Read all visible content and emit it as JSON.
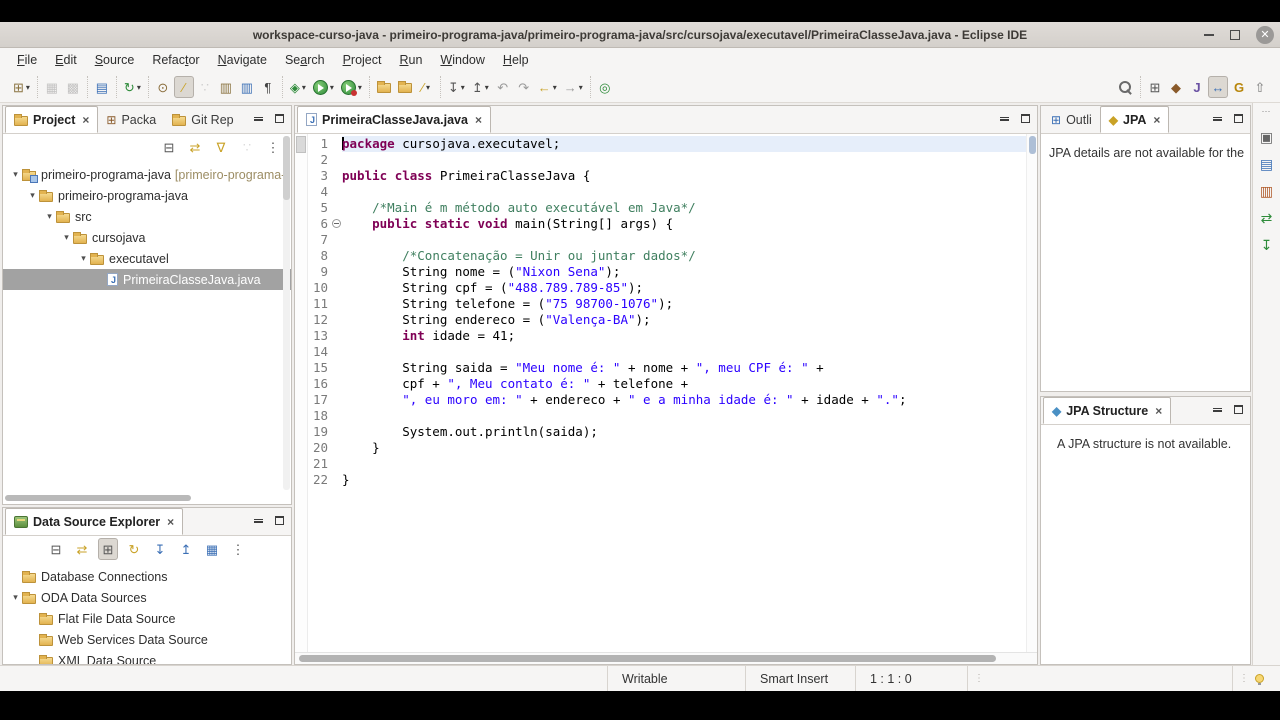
{
  "window": {
    "title": "workspace-curso-java - primeiro-programa-java/primeiro-programa-java/src/cursojava/executavel/PrimeiraClasseJava.java - Eclipse IDE"
  },
  "menu_bar": {
    "items": [
      {
        "label": "File",
        "m": 0
      },
      {
        "label": "Edit",
        "m": 0
      },
      {
        "label": "Source",
        "m": 0
      },
      {
        "label": "Refactor",
        "m": 5
      },
      {
        "label": "Navigate",
        "m": 0
      },
      {
        "label": "Search",
        "m": 2
      },
      {
        "label": "Project",
        "m": 0
      },
      {
        "label": "Run",
        "m": 0
      },
      {
        "label": "Window",
        "m": 0
      },
      {
        "label": "Help",
        "m": 0
      }
    ]
  },
  "toolbar": {
    "left_groups": [
      [
        {
          "name": "new-wizard-button",
          "glyph": "⊞",
          "color": "#8a7340",
          "dd": true
        }
      ],
      [
        {
          "name": "save-button",
          "glyph": "▦",
          "color": "#666",
          "disabled": true
        },
        {
          "name": "save-all-button",
          "glyph": "▩",
          "color": "#666",
          "disabled": true
        }
      ],
      [
        {
          "name": "console-button",
          "glyph": "▤",
          "color": "#3b6fb5"
        }
      ],
      [
        {
          "name": "run-last-tool-button",
          "glyph": "↻",
          "color": "#2e8b3a",
          "dd": true
        }
      ],
      [
        {
          "name": "open-search-dialog-button",
          "glyph": "⊙",
          "color": "#8a6d3b"
        },
        {
          "name": "mark-occurrences-button",
          "glyph": "∕",
          "color": "#c9a227",
          "pressed": true
        },
        {
          "name": "content-assist-button",
          "glyph": "∵",
          "color": "#888",
          "disabled": true
        },
        {
          "name": "open-task-button",
          "glyph": "▥",
          "color": "#8a7340"
        },
        {
          "name": "problems-view-button",
          "glyph": "▥",
          "color": "#3b6fb5"
        },
        {
          "name": "show-whitespace-button",
          "glyph": "¶",
          "color": "#444"
        }
      ],
      [
        {
          "name": "debug-button",
          "glyph": "◈",
          "color": "#2e8b3a",
          "dd": true
        },
        {
          "name": "run-button",
          "css": "run",
          "dd": true
        },
        {
          "name": "coverage-button",
          "css": "run-red",
          "dd": true
        }
      ],
      [
        {
          "name": "open-type-button",
          "css": "folder"
        },
        {
          "name": "open-resource-button",
          "css": "folder"
        },
        {
          "name": "annotate-button",
          "glyph": "∕",
          "color": "#c9a227",
          "dd": true
        }
      ],
      [
        {
          "name": "next-annotation-button",
          "glyph": "↧",
          "color": "#555",
          "dd": true
        },
        {
          "name": "previous-annotation-button",
          "glyph": "↥",
          "color": "#555",
          "dd": true
        },
        {
          "name": "last-edit-back-button",
          "glyph": "↶",
          "color": "#9a9a9a"
        },
        {
          "name": "last-edit-forward-button",
          "glyph": "↷",
          "color": "#9a9a9a"
        },
        {
          "name": "back-button",
          "glyph": "←",
          "color": "#c9a227",
          "dd": true
        },
        {
          "name": "forward-button",
          "glyph": "→",
          "color": "#9a9a9a",
          "dd": true
        }
      ],
      [
        {
          "name": "pin-editor-button",
          "glyph": "◎",
          "color": "#2e8b3a"
        }
      ]
    ],
    "right_groups": [
      [
        {
          "name": "search-button",
          "css": "magnifier"
        }
      ],
      [
        {
          "name": "open-perspective-button",
          "glyph": "⊞",
          "color": "#555"
        },
        {
          "name": "jpa-perspective-button",
          "glyph": "◆",
          "color": "#8a5a2a"
        },
        {
          "name": "java-perspective-button",
          "glyph": "J",
          "color": "#6a51a3"
        },
        {
          "name": "javaee-perspective-button",
          "glyph": "↔",
          "color": "#3b6fb5",
          "pressed": true
        },
        {
          "name": "git-perspective-button",
          "glyph": "G",
          "color": "#b8860b"
        },
        {
          "name": "resource-perspective-button",
          "glyph": "⇧",
          "color": "#777"
        }
      ]
    ]
  },
  "project_explorer": {
    "tabs": [
      {
        "name": "tab-project-explorer",
        "label": "Project",
        "close": true,
        "active": true,
        "icon": {
          "css": "folder",
          "name": "project-explorer-icon"
        }
      },
      {
        "name": "tab-package-explorer",
        "label": "Packa",
        "icon": {
          "glyph": "⊞",
          "color": "#8a5a2a",
          "name": "package-explorer-icon"
        }
      },
      {
        "name": "tab-git-repositories",
        "label": "Git Rep",
        "icon": {
          "css": "folder",
          "name": "git-repositories-icon"
        }
      }
    ],
    "toolbar": [
      {
        "name": "collapse-all-button",
        "glyph": "⊟",
        "color": "#555"
      },
      {
        "name": "link-with-editor-button",
        "glyph": "⇄",
        "color": "#c9a227"
      },
      {
        "name": "filters-button",
        "glyph": "∇",
        "color": "#c9a227"
      },
      {
        "name": "focus-button",
        "glyph": "∵",
        "color": "#999",
        "disabled": true
      },
      {
        "name": "view-menu-button",
        "glyph": "⋮",
        "color": "#555"
      }
    ],
    "tree": [
      {
        "label": "primeiro-programa-java",
        "deco": "[primeiro-programa-j",
        "level": 0,
        "icon": "project",
        "expanded": true
      },
      {
        "label": "primeiro-programa-java",
        "level": 1,
        "icon": "folder",
        "expanded": true
      },
      {
        "label": "src",
        "level": 2,
        "icon": "folder",
        "expanded": true
      },
      {
        "label": "cursojava",
        "level": 3,
        "icon": "folder",
        "expanded": true
      },
      {
        "label": "executavel",
        "level": 4,
        "icon": "folder",
        "expanded": true
      },
      {
        "label": "PrimeiraClasseJava.java",
        "level": 5,
        "icon": "javafile",
        "selected": true
      }
    ]
  },
  "editor": {
    "tab": {
      "name": "tab-editor-file",
      "label": "PrimeiraClasseJava.java",
      "close": true,
      "active": true,
      "icon": {
        "css": "javafile",
        "name": "java-file-icon"
      }
    },
    "lines": [
      {
        "n": 1,
        "current": true,
        "caret": true,
        "segs": [
          {
            "c": "kw",
            "t": "package"
          },
          {
            "c": "pl",
            "t": " cursojava.executavel;"
          }
        ]
      },
      {
        "n": 2,
        "segs": []
      },
      {
        "n": 3,
        "segs": [
          {
            "c": "kw",
            "t": "public"
          },
          {
            "c": "pl",
            "t": " "
          },
          {
            "c": "kw",
            "t": "class"
          },
          {
            "c": "pl",
            "t": " PrimeiraClasseJava {"
          }
        ]
      },
      {
        "n": 4,
        "segs": []
      },
      {
        "n": 5,
        "segs": [
          {
            "c": "pl",
            "t": "    "
          },
          {
            "c": "com",
            "t": "/*Main é m método auto executável em Java*/"
          }
        ]
      },
      {
        "n": 6,
        "fold": true,
        "segs": [
          {
            "c": "pl",
            "t": "    "
          },
          {
            "c": "kw",
            "t": "public"
          },
          {
            "c": "pl",
            "t": " "
          },
          {
            "c": "kw",
            "t": "static"
          },
          {
            "c": "pl",
            "t": " "
          },
          {
            "c": "kw",
            "t": "void"
          },
          {
            "c": "pl",
            "t": " main(String[] args) {"
          }
        ]
      },
      {
        "n": 7,
        "segs": []
      },
      {
        "n": 8,
        "segs": [
          {
            "c": "pl",
            "t": "        "
          },
          {
            "c": "com",
            "t": "/*Concatenação = Unir ou juntar dados*/"
          }
        ]
      },
      {
        "n": 9,
        "segs": [
          {
            "c": "pl",
            "t": "        String nome = ("
          },
          {
            "c": "str",
            "t": "\"Nixon Sena\""
          },
          {
            "c": "pl",
            "t": ");"
          }
        ]
      },
      {
        "n": 10,
        "segs": [
          {
            "c": "pl",
            "t": "        String cpf = ("
          },
          {
            "c": "str",
            "t": "\"488.789.789-85\""
          },
          {
            "c": "pl",
            "t": ");"
          }
        ]
      },
      {
        "n": 11,
        "segs": [
          {
            "c": "pl",
            "t": "        String telefone = ("
          },
          {
            "c": "str",
            "t": "\"75 98700-1076\""
          },
          {
            "c": "pl",
            "t": ");"
          }
        ]
      },
      {
        "n": 12,
        "segs": [
          {
            "c": "pl",
            "t": "        String endereco = ("
          },
          {
            "c": "str",
            "t": "\"Valença-BA\""
          },
          {
            "c": "pl",
            "t": ");"
          }
        ]
      },
      {
        "n": 13,
        "segs": [
          {
            "c": "pl",
            "t": "        "
          },
          {
            "c": "kw",
            "t": "int"
          },
          {
            "c": "pl",
            "t": " idade = 41;"
          }
        ]
      },
      {
        "n": 14,
        "segs": []
      },
      {
        "n": 15,
        "segs": [
          {
            "c": "pl",
            "t": "        String saida = "
          },
          {
            "c": "str",
            "t": "\"Meu nome é: \""
          },
          {
            "c": "pl",
            "t": " + nome + "
          },
          {
            "c": "str",
            "t": "\", meu CPF é: \""
          },
          {
            "c": "pl",
            "t": " +"
          }
        ]
      },
      {
        "n": 16,
        "segs": [
          {
            "c": "pl",
            "t": "        cpf + "
          },
          {
            "c": "str",
            "t": "\", Meu contato é: \""
          },
          {
            "c": "pl",
            "t": " + telefone +"
          }
        ]
      },
      {
        "n": 17,
        "segs": [
          {
            "c": "pl",
            "t": "        "
          },
          {
            "c": "str",
            "t": "\", eu moro em: \""
          },
          {
            "c": "pl",
            "t": " + endereco + "
          },
          {
            "c": "str",
            "t": "\" e a minha idade é: \""
          },
          {
            "c": "pl",
            "t": " + idade + "
          },
          {
            "c": "str",
            "t": "\".\""
          },
          {
            "c": "pl",
            "t": ";"
          }
        ]
      },
      {
        "n": 18,
        "segs": []
      },
      {
        "n": 19,
        "segs": [
          {
            "c": "pl",
            "t": "        System.out.println(saida);"
          }
        ]
      },
      {
        "n": 20,
        "segs": [
          {
            "c": "pl",
            "t": "    }"
          }
        ]
      },
      {
        "n": 21,
        "segs": []
      },
      {
        "n": 22,
        "segs": [
          {
            "c": "pl",
            "t": "}"
          }
        ]
      }
    ]
  },
  "outline_jpa_panel": {
    "tabs": [
      {
        "name": "tab-outline",
        "label": "Outli",
        "icon": {
          "glyph": "⊞",
          "color": "#3b6fb5",
          "name": "outline-icon"
        }
      },
      {
        "name": "tab-jpa-details",
        "label": "JPA",
        "close": true,
        "active": true,
        "icon": {
          "glyph": "◆",
          "color": "#c9a227",
          "name": "jpa-details-icon"
        }
      }
    ],
    "message": "JPA details are not available for the"
  },
  "jpa_structure_panel": {
    "tabs": [
      {
        "name": "tab-jpa-structure",
        "label": "JPA Structure",
        "close": true,
        "active": true,
        "icon": {
          "glyph": "◆",
          "color": "#4a90c4",
          "name": "jpa-structure-icon"
        }
      }
    ],
    "message": "A JPA structure is not available."
  },
  "data_source_explorer": {
    "tabs": [
      {
        "name": "tab-data-source-explorer",
        "label": "Data Source Explorer",
        "close": true,
        "active": true,
        "icon": {
          "css": "dse",
          "name": "data-source-explorer-icon"
        }
      }
    ],
    "toolbar": [
      {
        "name": "collapse-all-button",
        "glyph": "⊟",
        "color": "#555"
      },
      {
        "name": "link-with-editor-button",
        "glyph": "⇄",
        "color": "#c9a227"
      },
      {
        "name": "show-category-button",
        "glyph": "⊞",
        "color": "#555",
        "pressed": true
      },
      {
        "name": "refresh-button",
        "glyph": "↻",
        "color": "#c9a227"
      },
      {
        "name": "import-button",
        "glyph": "↧",
        "color": "#3b6fb5"
      },
      {
        "name": "export-button",
        "glyph": "↥",
        "color": "#3b6fb5"
      },
      {
        "name": "save-button",
        "glyph": "▦",
        "color": "#3b6fb5"
      },
      {
        "name": "view-menu-button",
        "glyph": "⋮",
        "color": "#555"
      }
    ],
    "tree": [
      {
        "label": "Database Connections",
        "level": 0,
        "icon": "folder"
      },
      {
        "label": "ODA Data Sources",
        "level": 0,
        "icon": "folder",
        "expanded": true
      },
      {
        "label": "Flat File Data Source",
        "level": 1,
        "icon": "folder"
      },
      {
        "label": "Web Services Data Source",
        "level": 1,
        "icon": "folder"
      },
      {
        "label": "XML Data Source",
        "level": 1,
        "icon": "folder"
      }
    ]
  },
  "mini_bar": {
    "icons": [
      {
        "name": "restore-views-icon",
        "glyph": "▣",
        "color": "#666"
      },
      {
        "name": "console-view-icon",
        "glyph": "▤",
        "color": "#3b6fb5"
      },
      {
        "name": "report-view-icon",
        "glyph": "▥",
        "color": "#b05a2a"
      },
      {
        "name": "synchronize-view-icon",
        "glyph": "⇄",
        "color": "#2e8b3a"
      },
      {
        "name": "import-wizard-icon",
        "glyph": "↧",
        "color": "#2e8b3a"
      }
    ]
  },
  "status_bar": {
    "writable": "Writable",
    "insert_mode": "Smart Insert",
    "position": "1 : 1 : 0"
  },
  "colors": {
    "keyword": "#7f0055",
    "string": "#2a00ff",
    "comment": "#3f7f5f",
    "current_line": "#e6eefa",
    "tree_selection": "#a2a2a2",
    "chrome": "#f6f5f4"
  }
}
